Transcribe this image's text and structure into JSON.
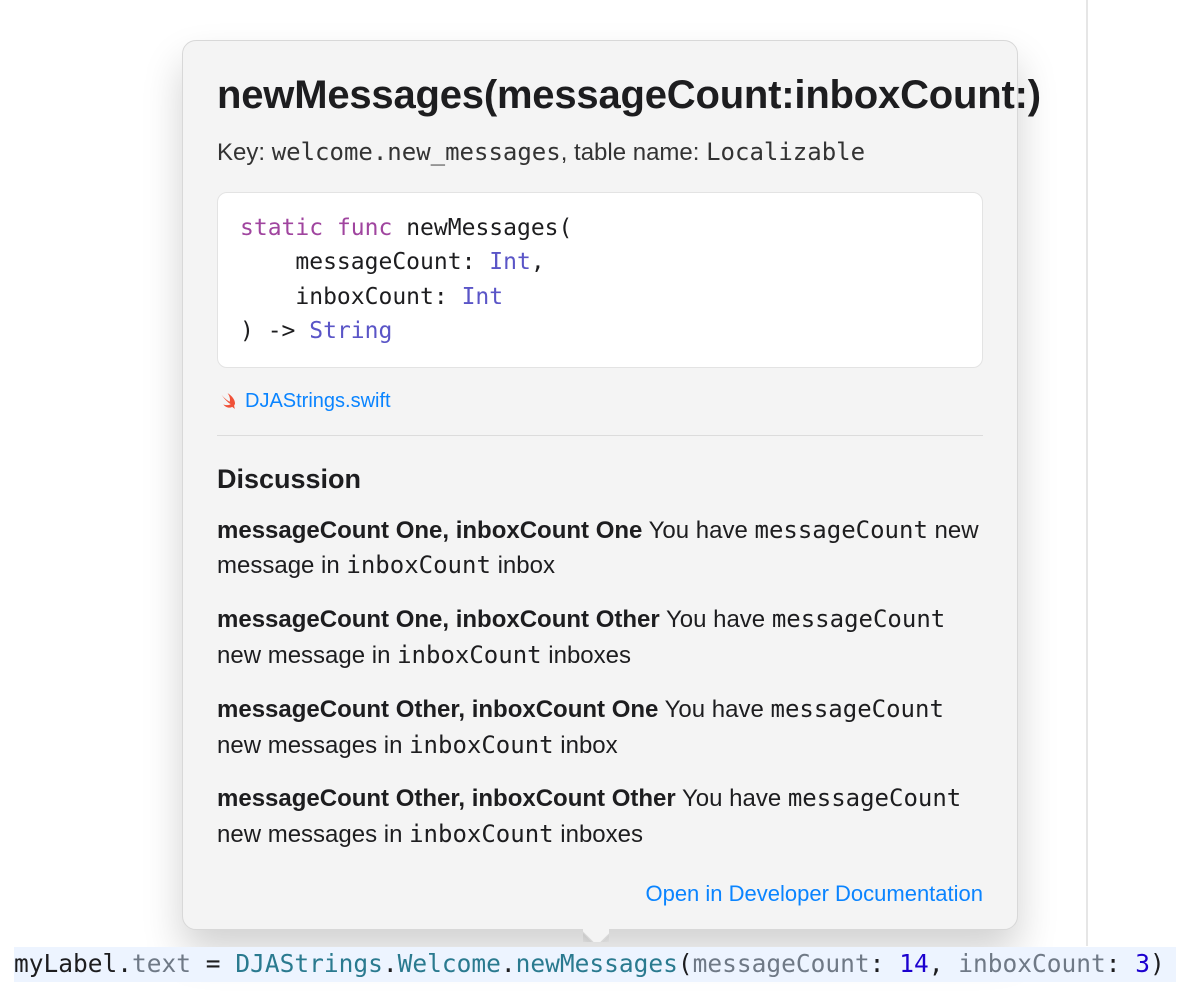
{
  "popover": {
    "title": "newMessages(messageCount:inboxCount:)",
    "subtitle": {
      "key_label": "Key:",
      "key_value": "welcome.new_messages",
      "sep": ", table name:",
      "table_value": "Localizable"
    },
    "signature": {
      "kw_static": "static",
      "kw_func": "func",
      "fn_name": "newMessages",
      "open": "(",
      "param1_name": "messageCount",
      "param1_type": "Int",
      "param2_name": "inboxCount",
      "param2_type": "Int",
      "close": ") ->",
      "ret_type": "String"
    },
    "file_link": "DJAStrings.swift",
    "discussion_heading": "Discussion",
    "discussion": [
      {
        "label": "messageCount One, inboxCount One",
        "text_pre": " You have ",
        "m1": "messageCount",
        "text_mid": " new message in ",
        "m2": "inboxCount",
        "text_post": " inbox"
      },
      {
        "label": "messageCount One, inboxCount Other",
        "text_pre": " You have ",
        "m1": "messageCount",
        "text_mid": " new message in ",
        "m2": "inboxCount",
        "text_post": " inboxes"
      },
      {
        "label": "messageCount Other, inboxCount One",
        "text_pre": " You have ",
        "m1": "messageCount",
        "text_mid": " new messages in ",
        "m2": "inboxCount",
        "text_post": " inbox"
      },
      {
        "label": "messageCount Other, inboxCount Other",
        "text_pre": " You have ",
        "m1": "messageCount",
        "text_mid": " new messages in ",
        "m2": "inboxCount",
        "text_post": " inboxes"
      }
    ],
    "footer_link": "Open in Developer Documentation"
  },
  "code_line": {
    "t0": "myLabel",
    "dot1": ".",
    "t1": "text",
    "eq": " = ",
    "t2": "DJAStrings",
    "dot2": ".",
    "t3": "Welcome",
    "dot3": ".",
    "t4": "newMessages",
    "open": "(",
    "p1": "messageCount",
    "colon1": ": ",
    "n1": "14",
    "comma": ", ",
    "p2": "inboxCount",
    "colon2": ": ",
    "n2": "3",
    "close": ")"
  }
}
